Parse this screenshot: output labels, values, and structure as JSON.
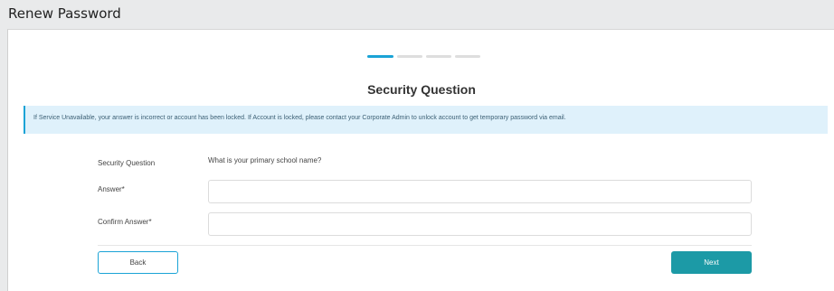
{
  "window": {
    "title": "Renew Password"
  },
  "stepper": {
    "total_steps": 4,
    "current_step": 1
  },
  "section": {
    "title": "Security Question"
  },
  "info_banner": {
    "message": "If Service Unavailable, your answer is incorrect or account has been locked. If Account is locked, please contact your Corporate Admin to unlock account to get temporary password via email."
  },
  "form": {
    "security_question_label": "Security Question",
    "security_question_value": "What is your primary school name?",
    "answer_label": "Answer*",
    "answer_value": "",
    "confirm_answer_label": "Confirm Answer*",
    "confirm_answer_value": ""
  },
  "buttons": {
    "back_label": "Back",
    "next_label": "Next"
  },
  "colors": {
    "accent": "#1aa3d6",
    "primary_button": "#1c9aa6",
    "banner_background": "#dff1fb"
  }
}
